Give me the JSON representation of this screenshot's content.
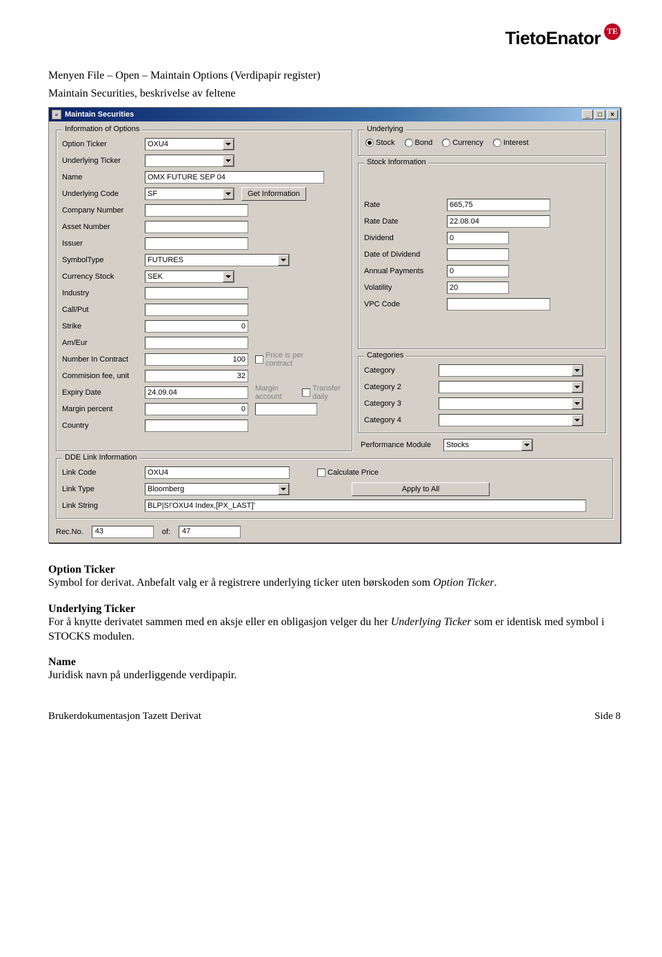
{
  "logo": {
    "brand": "TietoEnator",
    "badge": "TE"
  },
  "doc": {
    "heading1": "Menyen File – Open – Maintain Options (Verdipapir register)",
    "heading2": "Maintain Securities, beskrivelse av feltene",
    "sections": {
      "option_ticker": {
        "title": "Option Ticker",
        "p1a": "Symbol for derivat. Anbefalt valg er å registrere underlying ticker uten børskoden som ",
        "p1b_i": "Option Ticker",
        "p1c": "."
      },
      "underlying_ticker": {
        "title": "Underlying Ticker",
        "p1a": "For å knytte derivatet sammen med en aksje eller en obligasjon velger du her ",
        "p1b_i": "Underlying Ticker",
        "p1c": " som er identisk med symbol i STOCKS modulen."
      },
      "name": {
        "title": "Name",
        "p1": "Juridisk navn på underliggende verdipapir."
      }
    },
    "footer_left": "Brukerdokumentasjon Tazett Derivat",
    "footer_right": "Side 8"
  },
  "dlg": {
    "title": "Maintain Securities",
    "winbtns": {
      "min": "_",
      "max": "□",
      "close": "×"
    },
    "groups": {
      "info": "Information of Options",
      "underlying": "Underlying",
      "stockinfo": "Stock Information",
      "categories": "Categories",
      "dde": "DDE Link Information"
    },
    "labels": {
      "option_ticker": "Option Ticker",
      "underlying_ticker": "Underlying Ticker",
      "name": "Name",
      "underlying_code": "Underlying Code",
      "company_number": "Company Number",
      "asset_number": "Asset Number",
      "issuer": "Issuer",
      "symbol_type": "SymbolType",
      "currency_stock": "Currency Stock",
      "industry": "Industry",
      "call_put": "Call/Put",
      "strike": "Strike",
      "am_eur": "Am/Eur",
      "number_in_contract": "Number In Contract",
      "commision_fee": "Commision fee, unit",
      "expiry_date": "Expiry Date",
      "margin_percent": "Margin percent",
      "country": "Country",
      "rate": "Rate",
      "rate_date": "Rate Date",
      "dividend": "Dividend",
      "date_of_dividend": "Date of Dividend",
      "annual_payments": "Annual Payments",
      "volatility": "Volatility",
      "vpc_code": "VPC Code",
      "category": "Category",
      "category2": "Category 2",
      "category3": "Category 3",
      "category4": "Category 4",
      "perf_module": "Performance Module",
      "link_code": "Link Code",
      "link_type": "Link Type",
      "link_string": "Link String",
      "calc_price": "Calculate Price",
      "apply_all": "Apply to All",
      "get_info": "Get Information",
      "price_per": "Price is per contract",
      "margin_account": "Margin account",
      "transfer_daily": "Transfer daily",
      "rec_no": "Rec.No.",
      "of": "of:"
    },
    "radios": {
      "stock": "Stock",
      "bond": "Bond",
      "currency": "Currency",
      "interest": "Interest",
      "selected": "stock"
    },
    "values": {
      "option_ticker": "OXU4",
      "underlying_ticker": "",
      "name": "OMX FUTURE SEP 04",
      "underlying_code": "SF",
      "company_number": "",
      "asset_number": "",
      "issuer": "",
      "symbol_type": "FUTURES",
      "currency_stock": "SEK",
      "industry": "",
      "call_put": "",
      "strike": "0",
      "am_eur": "",
      "number_in_contract": "100",
      "commision_fee": "32",
      "expiry_date": "24.09.04",
      "margin_percent": "0",
      "country": "",
      "rate": "665,75",
      "rate_date": "22.08.04",
      "dividend": "0",
      "date_of_dividend": "",
      "annual_payments": "0",
      "volatility": "20",
      "vpc_code": "",
      "category": "",
      "category2": "",
      "category3": "",
      "category4": "",
      "perf_module": "Stocks",
      "link_code": "OXU4",
      "link_type": "Bloomberg",
      "link_string": "BLP|S!'OXU4 Index,[PX_LAST]'",
      "rec_no": "43",
      "of": "47"
    }
  }
}
